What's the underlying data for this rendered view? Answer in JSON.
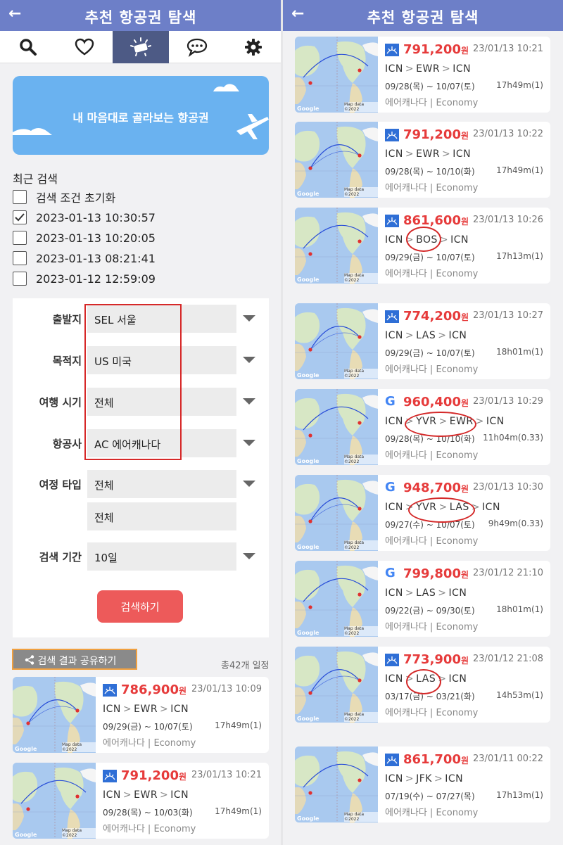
{
  "header": {
    "title": "추천 항공권 탐색",
    "back_icon": "←"
  },
  "tabs": [
    {
      "name": "search-icon"
    },
    {
      "name": "heart-icon"
    },
    {
      "name": "ticket-icon",
      "active": true
    },
    {
      "name": "chat-icon"
    },
    {
      "name": "gear-icon"
    }
  ],
  "banner": {
    "text": "내 마음대로 골라보는 항공권"
  },
  "recent": {
    "title": "최근 검색",
    "items": [
      {
        "label": "검색 조건 초기화",
        "checked": false
      },
      {
        "label": "2023-01-13 10:30:57",
        "checked": true
      },
      {
        "label": "2023-01-13 10:20:05",
        "checked": false
      },
      {
        "label": "2023-01-13 08:21:41",
        "checked": false
      },
      {
        "label": "2023-01-12 12:59:09",
        "checked": false
      }
    ]
  },
  "form": {
    "departure": {
      "label": "출발지",
      "value": "SEL 서울"
    },
    "destination": {
      "label": "목적지",
      "value": "US 미국"
    },
    "travel_time": {
      "label": "여행 시기",
      "value": "전체"
    },
    "airline": {
      "label": "항공사",
      "value": "AC 에어캐나다"
    },
    "trip_type": {
      "label": "여정 타입",
      "value": "전체",
      "value2": "전체"
    },
    "period": {
      "label": "검색 기간",
      "value": "10일"
    },
    "search_button": "검색하기"
  },
  "share": {
    "label": "검색 결과 공유하기",
    "total": "총42개 일정"
  },
  "colors": {
    "accent": "#6d7fc8",
    "price": "#e63b3b",
    "button": "#ed5a5a"
  },
  "map_labels": {
    "google": "Google",
    "mapdata": "Map data ©2022"
  },
  "results_left": [
    {
      "logo": "ac",
      "price": "786,900",
      "won": "원",
      "time": "23/01/13 10:09",
      "route": [
        "ICN",
        "EWR",
        "ICN"
      ],
      "dates": "09/29(금) ~ 10/07(토)",
      "duration": "17h49m(1)",
      "airline": "에어캐나다 | Economy"
    },
    {
      "logo": "ac",
      "price": "791,200",
      "won": "원",
      "time": "23/01/13 10:21",
      "route": [
        "ICN",
        "EWR",
        "ICN"
      ],
      "dates": "09/28(목) ~ 10/03(화)",
      "duration": "17h49m(1)",
      "airline": "에어캐나다 | Economy"
    }
  ],
  "results_right": [
    {
      "logo": "ac",
      "price": "791,200",
      "won": "원",
      "time": "23/01/13 10:21",
      "route": [
        "ICN",
        "EWR",
        "ICN"
      ],
      "dates": "09/28(목) ~ 10/07(토)",
      "duration": "17h49m(1)",
      "airline": "에어캐나다 | Economy"
    },
    {
      "logo": "ac",
      "price": "791,200",
      "won": "원",
      "time": "23/01/13 10:22",
      "route": [
        "ICN",
        "EWR",
        "ICN"
      ],
      "dates": "09/28(목) ~ 10/10(화)",
      "duration": "17h49m(1)",
      "airline": "에어캐나다 | Economy"
    },
    {
      "logo": "ac",
      "price": "861,600",
      "won": "원",
      "time": "23/01/13 10:26",
      "route": [
        "ICN",
        "BOS",
        "ICN"
      ],
      "dates": "09/29(금) ~ 10/07(토)",
      "duration": "17h13m(1)",
      "airline": "에어캐나다 | Economy"
    },
    {
      "logo": "ac",
      "price": "774,200",
      "won": "원",
      "time": "23/01/13 10:27",
      "route": [
        "ICN",
        "LAS",
        "ICN"
      ],
      "dates": "09/29(금) ~ 10/07(토)",
      "duration": "18h01m(1)",
      "airline": "에어캐나다 | Economy"
    },
    {
      "logo": "g",
      "price": "960,400",
      "won": "원",
      "time": "23/01/13 10:29",
      "route": [
        "ICN",
        "YVR",
        "EWR",
        "ICN"
      ],
      "dates": "09/28(목) ~ 10/10(화)",
      "duration": "11h04m(0.33)",
      "airline": "에어캐나다 | Economy"
    },
    {
      "logo": "g",
      "price": "948,700",
      "won": "원",
      "time": "23/01/13 10:30",
      "route": [
        "ICN",
        "YVR",
        "LAS",
        "ICN"
      ],
      "dates": "09/27(수) ~ 10/07(토)",
      "duration": "9h49m(0.33)",
      "airline": "에어캐나다 | Economy"
    },
    {
      "logo": "g",
      "price": "799,800",
      "won": "원",
      "time": "23/01/12 21:10",
      "route": [
        "ICN",
        "LAS",
        "ICN"
      ],
      "dates": "09/22(금) ~ 09/30(토)",
      "duration": "18h01m(1)",
      "airline": "에어캐나다 | Economy"
    },
    {
      "logo": "ac",
      "price": "773,900",
      "won": "원",
      "time": "23/01/12 21:08",
      "route": [
        "ICN",
        "LAS",
        "ICN"
      ],
      "dates": "03/17(금) ~ 03/21(화)",
      "duration": "14h53m(1)",
      "airline": "에어캐나다 | Economy"
    },
    {
      "logo": "ac",
      "price": "861,700",
      "won": "원",
      "time": "23/01/11 00:22",
      "route": [
        "ICN",
        "JFK",
        "ICN"
      ],
      "dates": "07/19(수) ~ 07/27(목)",
      "duration": "17h13m(1)",
      "airline": "에어캐나다 | Economy"
    }
  ]
}
